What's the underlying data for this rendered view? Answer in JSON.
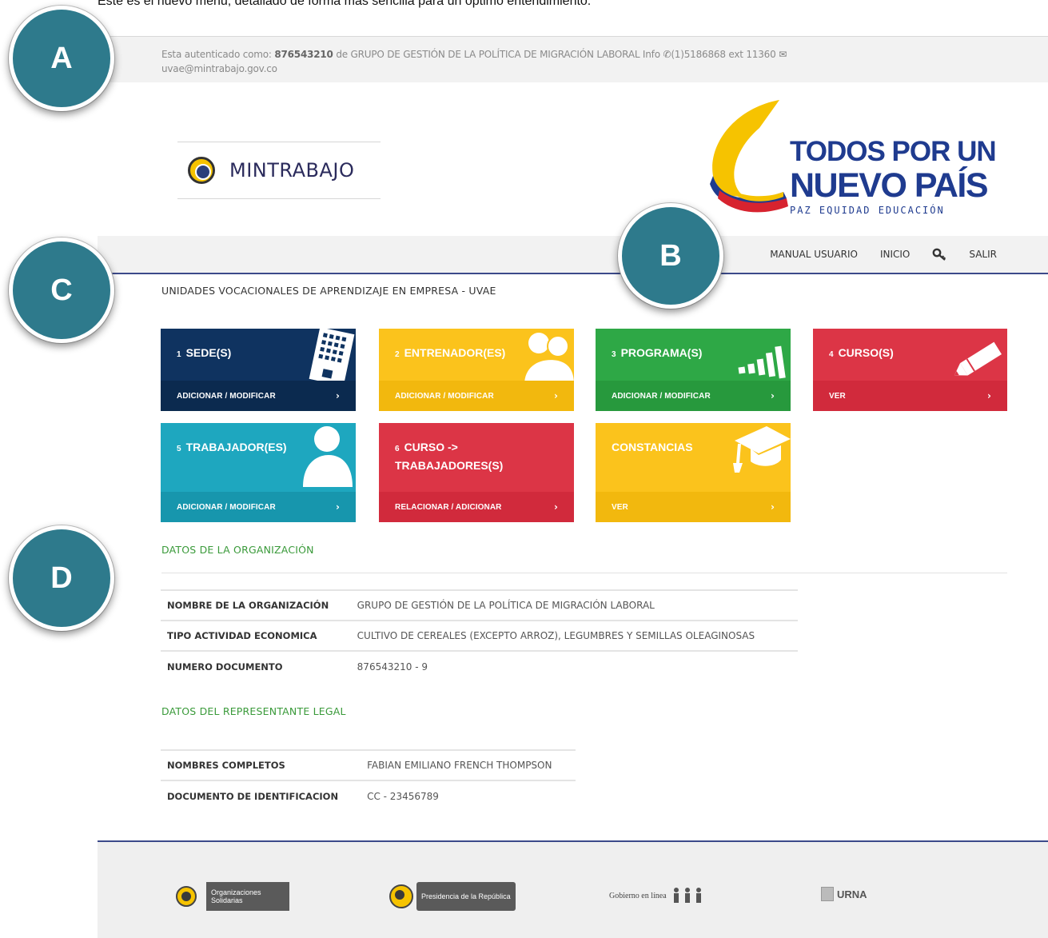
{
  "caption": "Este es el nuevo menú, detallado de forma más sencilla para un óptimo entendimiento.",
  "callouts": {
    "a": "A",
    "b": "B",
    "c": "C",
    "d": "D"
  },
  "auth": {
    "prefix": "Esta autenticado como: ",
    "user_id": "876543210",
    "middle": " de GRUPO DE GESTIÓN DE LA POLÍTICA DE MIGRACIÓN LABORAL  Info ",
    "phone": "(1)5186868 ext 11360",
    "email": "uvae@mintrabajo.gov.co"
  },
  "logos": {
    "mintrabajo": "MINTRABAJO",
    "campaign_line1": "TODOS POR UN",
    "campaign_line2": "NUEVO PAÍS",
    "campaign_line3": "PAZ  EQUIDAD  EDUCACIÓN"
  },
  "nav": {
    "manual": "MANUAL USUARIO",
    "home": "INICIO",
    "logout": "SALIR",
    "key_icon": "key-icon"
  },
  "section_title": "UNIDADES VOCACIONALES DE APRENDIZAJE EN EMPRESA - UVAE",
  "tiles": [
    {
      "num": "1",
      "label": "SEDE(S)",
      "action": "ADICIONAR / MODIFICAR",
      "color": "#0f3360",
      "bottom": "#0b2a4f",
      "icon": "building-icon"
    },
    {
      "num": "2",
      "label": "ENTRENADOR(ES)",
      "action": "ADICIONAR / MODIFICAR",
      "color": "#fbc31c",
      "bottom": "#f2b80e",
      "icon": "users-icon"
    },
    {
      "num": "3",
      "label": "PROGRAMA(S)",
      "action": "ADICIONAR / MODIFICAR",
      "color": "#2ea846",
      "bottom": "#27993d",
      "icon": "signal-bars-icon"
    },
    {
      "num": "4",
      "label": "CURSO(S)",
      "action": "VER",
      "color": "#dc3546",
      "bottom": "#d12a3c",
      "icon": "pencil-icon"
    },
    {
      "num": "5",
      "label": "TRABAJADOR(ES)",
      "action": "ADICIONAR / MODIFICAR",
      "color": "#1ea7bf",
      "bottom": "#1796ad",
      "icon": "user-icon"
    },
    {
      "num": "6",
      "label_line1": "CURSO ->",
      "label_line2": "TRABAJADORES(S)",
      "action": "RELACIONAR / ADICIONAR",
      "color": "#dc3546",
      "bottom": "#d12a3c"
    },
    {
      "label": "CONSTANCIAS",
      "action": "VER",
      "color": "#fbc31c",
      "bottom": "#f2b80e",
      "icon": "graduation-cap-icon"
    }
  ],
  "tile_chevron": "›",
  "org": {
    "heading": "DATOS DE LA ORGANIZACIÓN",
    "rows": [
      {
        "k": "NOMBRE DE LA ORGANIZACIÓN",
        "v": "GRUPO DE GESTIÓN DE LA POLÍTICA DE MIGRACIÓN LABORAL"
      },
      {
        "k": "TIPO ACTIVIDAD ECONOMICA",
        "v": "CULTIVO DE CEREALES (EXCEPTO ARROZ), LEGUMBRES Y SEMILLAS OLEAGINOSAS"
      },
      {
        "k": "NUMERO DOCUMENTO",
        "v": "876543210 - 9"
      }
    ]
  },
  "rep": {
    "heading": "DATOS DEL REPRESENTANTE LEGAL",
    "rows": [
      {
        "k": "NOMBRES COMPLETOS",
        "v": "FABIAN EMILIANO FRENCH THOMPSON"
      },
      {
        "k": "DOCUMENTO DE IDENTIFICACION",
        "v": "CC - 23456789"
      }
    ]
  },
  "footer": {
    "org_solidarias": "Organizaciones Solidarias",
    "presidencia": "Presidencia de la República",
    "gobierno": "Gobierno en línea",
    "urna": "URNA"
  }
}
